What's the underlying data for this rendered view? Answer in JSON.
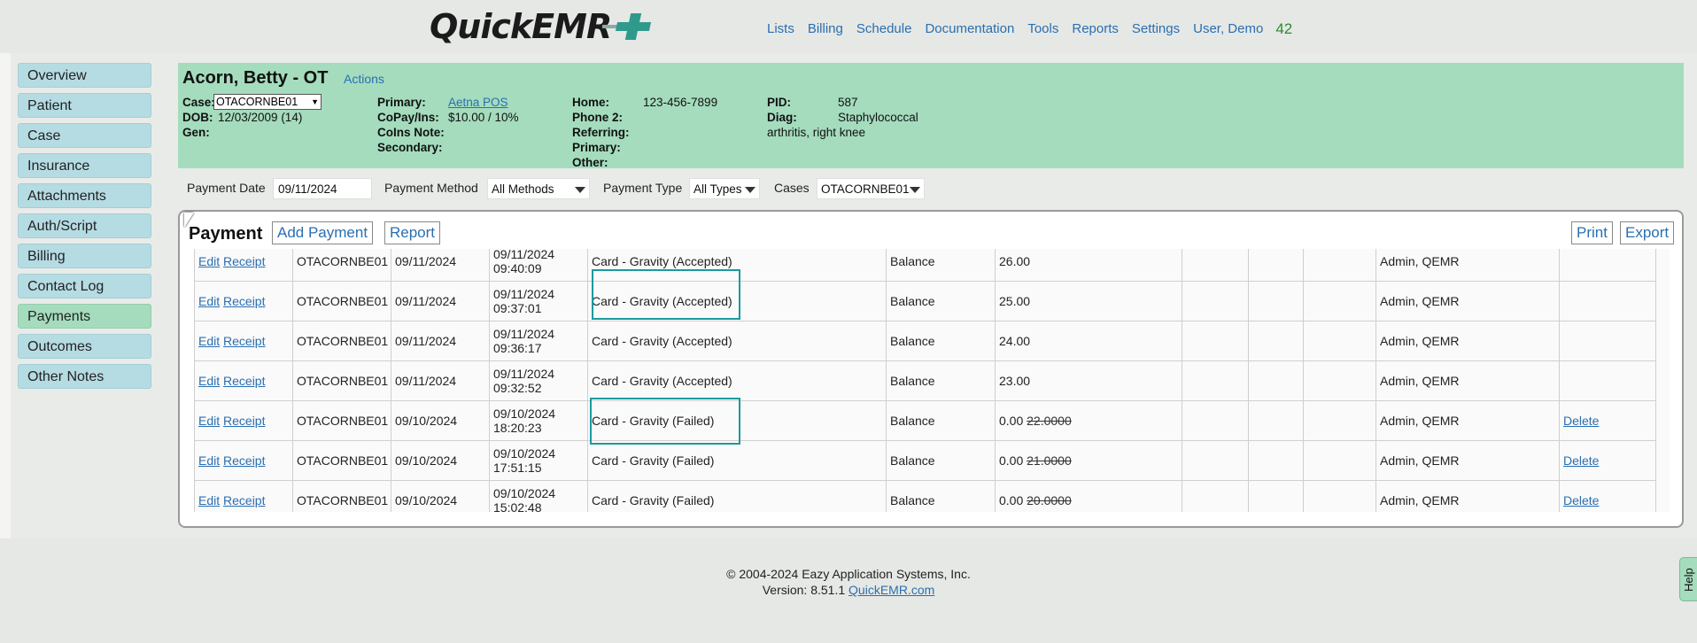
{
  "app": {
    "logo_text": "QuickEMR",
    "nav": [
      "Lists",
      "Billing",
      "Schedule",
      "Documentation",
      "Tools",
      "Reports",
      "Settings",
      "User, Demo"
    ],
    "notification_count": "42"
  },
  "sidebar": {
    "items": [
      {
        "label": "Overview"
      },
      {
        "label": "Patient"
      },
      {
        "label": "Case"
      },
      {
        "label": "Insurance"
      },
      {
        "label": "Attachments"
      },
      {
        "label": "Auth/Script"
      },
      {
        "label": "Billing"
      },
      {
        "label": "Contact Log"
      },
      {
        "label": "Payments"
      },
      {
        "label": "Outcomes"
      },
      {
        "label": "Other Notes"
      }
    ],
    "active": "Payments"
  },
  "patient": {
    "name": "Acorn, Betty - OT",
    "actions_label": "Actions",
    "case_label": "Case:",
    "case_value": "OTACORNBE01",
    "dob_label": "DOB:",
    "dob_value": "12/03/2009 (14)",
    "gen_label": "Gen:",
    "primary_label": "Primary:",
    "primary_value": "Aetna POS",
    "copay_label": "CoPay/Ins:",
    "copay_value": "$10.00 / 10%",
    "coins_label": "CoIns Note:",
    "secondary_label": "Secondary:",
    "home_label": "Home:",
    "home_value": "123-456-7899",
    "phone2_label": "Phone 2:",
    "referring_label": "Referring:",
    "primary2_label": "Primary:",
    "other_label": "Other:",
    "pid_label": "PID:",
    "pid_value": "587",
    "diag_label": "Diag:",
    "diag_line1": "Staphylococcal",
    "diag_line2": "arthritis, right knee"
  },
  "filters": {
    "payment_date_label": "Payment Date",
    "payment_date_value": "09/11/2024",
    "payment_method_label": "Payment Method",
    "payment_method_value": "All Methods",
    "payment_type_label": "Payment Type",
    "payment_type_value": "All Types",
    "cases_label": "Cases",
    "cases_value": "OTACORNBE01"
  },
  "payment": {
    "title": "Payment",
    "add_label": "Add Payment",
    "report_label": "Report",
    "print_label": "Print",
    "export_label": "Export",
    "edit_label": "Edit",
    "receipt_label": "Receipt",
    "delete_label": "Delete",
    "rows": [
      {
        "case": "OTACORNBE01",
        "date": "09/11/2024",
        "dt1": "09/11/2024",
        "dt2": "09:40:09",
        "method": "Card - Gravity (Accepted)",
        "type": "Balance",
        "amount": "26.00",
        "orig": "",
        "user": "Admin, QEMR",
        "deletable": false
      },
      {
        "case": "OTACORNBE01",
        "date": "09/11/2024",
        "dt1": "09/11/2024",
        "dt2": "09:37:01",
        "method": "Card - Gravity (Accepted)",
        "type": "Balance",
        "amount": "25.00",
        "orig": "",
        "user": "Admin, QEMR",
        "deletable": false
      },
      {
        "case": "OTACORNBE01",
        "date": "09/11/2024",
        "dt1": "09/11/2024",
        "dt2": "09:36:17",
        "method": "Card - Gravity (Accepted)",
        "type": "Balance",
        "amount": "24.00",
        "orig": "",
        "user": "Admin, QEMR",
        "deletable": false
      },
      {
        "case": "OTACORNBE01",
        "date": "09/11/2024",
        "dt1": "09/11/2024",
        "dt2": "09:32:52",
        "method": "Card - Gravity (Accepted)",
        "type": "Balance",
        "amount": "23.00",
        "orig": "",
        "user": "Admin, QEMR",
        "deletable": false
      },
      {
        "case": "OTACORNBE01",
        "date": "09/10/2024",
        "dt1": "09/10/2024",
        "dt2": "18:20:23",
        "method": "Card - Gravity (Failed)",
        "type": "Balance",
        "amount": "0.00",
        "orig": "22.0000",
        "user": "Admin, QEMR",
        "deletable": true
      },
      {
        "case": "OTACORNBE01",
        "date": "09/10/2024",
        "dt1": "09/10/2024",
        "dt2": "17:51:15",
        "method": "Card - Gravity (Failed)",
        "type": "Balance",
        "amount": "0.00",
        "orig": "21.0000",
        "user": "Admin, QEMR",
        "deletable": true
      },
      {
        "case": "OTACORNBE01",
        "date": "09/10/2024",
        "dt1": "09/10/2024",
        "dt2": "15:02:48",
        "method": "Card - Gravity (Failed)",
        "type": "Balance",
        "amount": "0.00",
        "orig": "20.0000",
        "user": "Admin, QEMR",
        "deletable": true
      }
    ]
  },
  "footer": {
    "copyright": "© 2004-2024 Eazy Application Systems, Inc.",
    "version_prefix": "Version: 8.51.1 ",
    "version_link": "QuickEMR.com"
  },
  "help_label": "Help",
  "colors": {
    "accent_green": "#a4dcbd",
    "sidebar_blue": "#b5dbe3",
    "link_blue": "#2a6fb0",
    "highlight_teal": "#1b9aa0"
  }
}
